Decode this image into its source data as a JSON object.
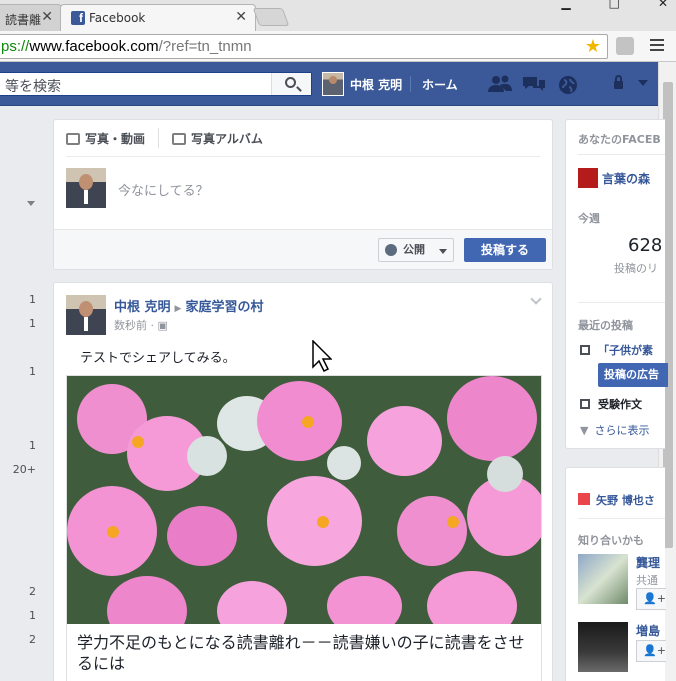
{
  "browser": {
    "inactive_tab_title": "読書離",
    "active_tab_title": "Facebook",
    "tab_close_glyph": "✕",
    "url_scheme": "ps://",
    "url_host": "www.facebook.com",
    "url_path": "/?ref=tn_tnmn"
  },
  "fbbar": {
    "search_placeholder": "等を検索",
    "user_name": "中根 克明",
    "home_label": "ホーム"
  },
  "left_counts": [
    "1",
    "1",
    "1",
    "1",
    "20+",
    "2",
    "1",
    "2"
  ],
  "composer": {
    "tab_photo": "写真・動画",
    "tab_album": "写真アルバム",
    "placeholder": "今なにしてる？",
    "privacy_label": "公開",
    "post_button": "投稿する"
  },
  "post": {
    "author": "中根 克明",
    "group": "家庭学習の村",
    "meta": "数秒前 · ▣",
    "text": "テストでシェアしてみる。",
    "link_title": "学力不足のもとになる読書離れ－－読書嫌いの子に読書をさせるには"
  },
  "rail": {
    "header": "あなたのFACEB",
    "page_name": "言葉の森",
    "week_label": "今週",
    "count": "628",
    "count_label": "投稿のリ",
    "recent_label": "最近の投稿",
    "recent_post1": "「子供が素",
    "boost_button": "投稿の広告",
    "recent_post2": "受験作文",
    "see_more": "さらに表示",
    "birthday_name": "矢野 博也さ",
    "pymk_label": "知り合いかも",
    "people": [
      {
        "name": "龔理",
        "sub": "共通",
        "add": "👤+"
      },
      {
        "name": "増島",
        "sub": "",
        "add": "👤+"
      }
    ]
  },
  "colors": {
    "fb_blue": "#3b5998",
    "button_blue": "#4267b2",
    "link": "#365899"
  }
}
